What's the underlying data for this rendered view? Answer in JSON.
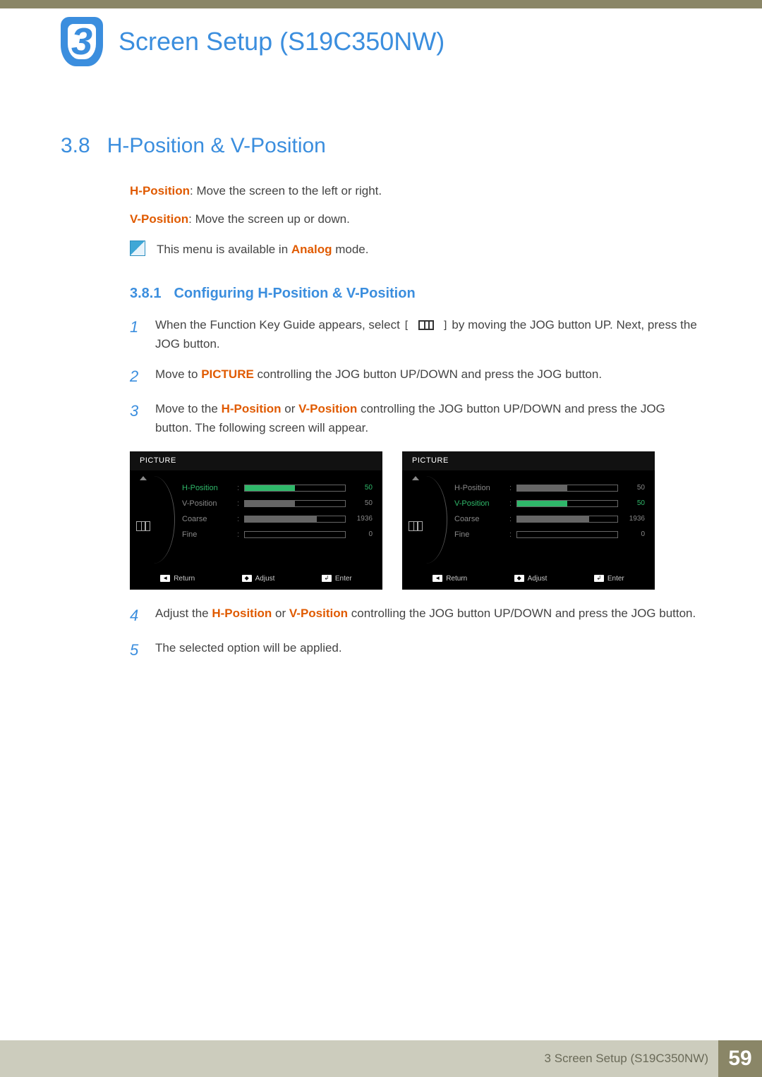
{
  "chapter": {
    "number": "3",
    "title": "Screen Setup (S19C350NW)"
  },
  "section": {
    "number": "3.8",
    "title": "H-Position & V-Position"
  },
  "intro": {
    "hp_label": "H-Position",
    "hp_desc": ": Move the screen to the left or right.",
    "vp_label": "V-Position",
    "vp_desc": ": Move the screen up or down.",
    "note_pre": "This menu is available in ",
    "note_hl": "Analog",
    "note_post": " mode."
  },
  "subsection": {
    "number": "3.8.1",
    "title": "Configuring H-Position & V-Position"
  },
  "steps": {
    "s1a": "When the Function Key Guide appears, select ",
    "s1b": " by moving the JOG button UP. Next, press the JOG button.",
    "s2a": "Move to ",
    "s2_picture": "PICTURE",
    "s2b": " controlling the JOG button UP/DOWN and press the JOG button.",
    "s3a": "Move to the ",
    "s3_hp": "H-Position",
    "s3_or": " or  ",
    "s3_vp": "V-Position",
    "s3b": " controlling the JOG button UP/DOWN and press the JOG button. The following screen will appear.",
    "s4a": "Adjust the ",
    "s4_hp": "H-Position",
    "s4_or": " or ",
    "s4_vp": "V-Position",
    "s4b": " controlling the JOG button UP/DOWN and press the JOG button.",
    "s5": "The selected option will be applied."
  },
  "osd": {
    "title": "PICTURE",
    "items": [
      {
        "label": "H-Position",
        "value": "50",
        "fill": 50
      },
      {
        "label": "V-Position",
        "value": "50",
        "fill": 50
      },
      {
        "label": "Coarse",
        "value": "1936",
        "fill": 72
      },
      {
        "label": "Fine",
        "value": "0",
        "fill": 0
      }
    ],
    "left_active_index": 0,
    "right_active_index": 1,
    "footer": {
      "return": "Return",
      "adjust": "Adjust",
      "enter": "Enter"
    }
  },
  "footer": {
    "text": "3 Screen Setup (S19C350NW)",
    "page": "59"
  }
}
